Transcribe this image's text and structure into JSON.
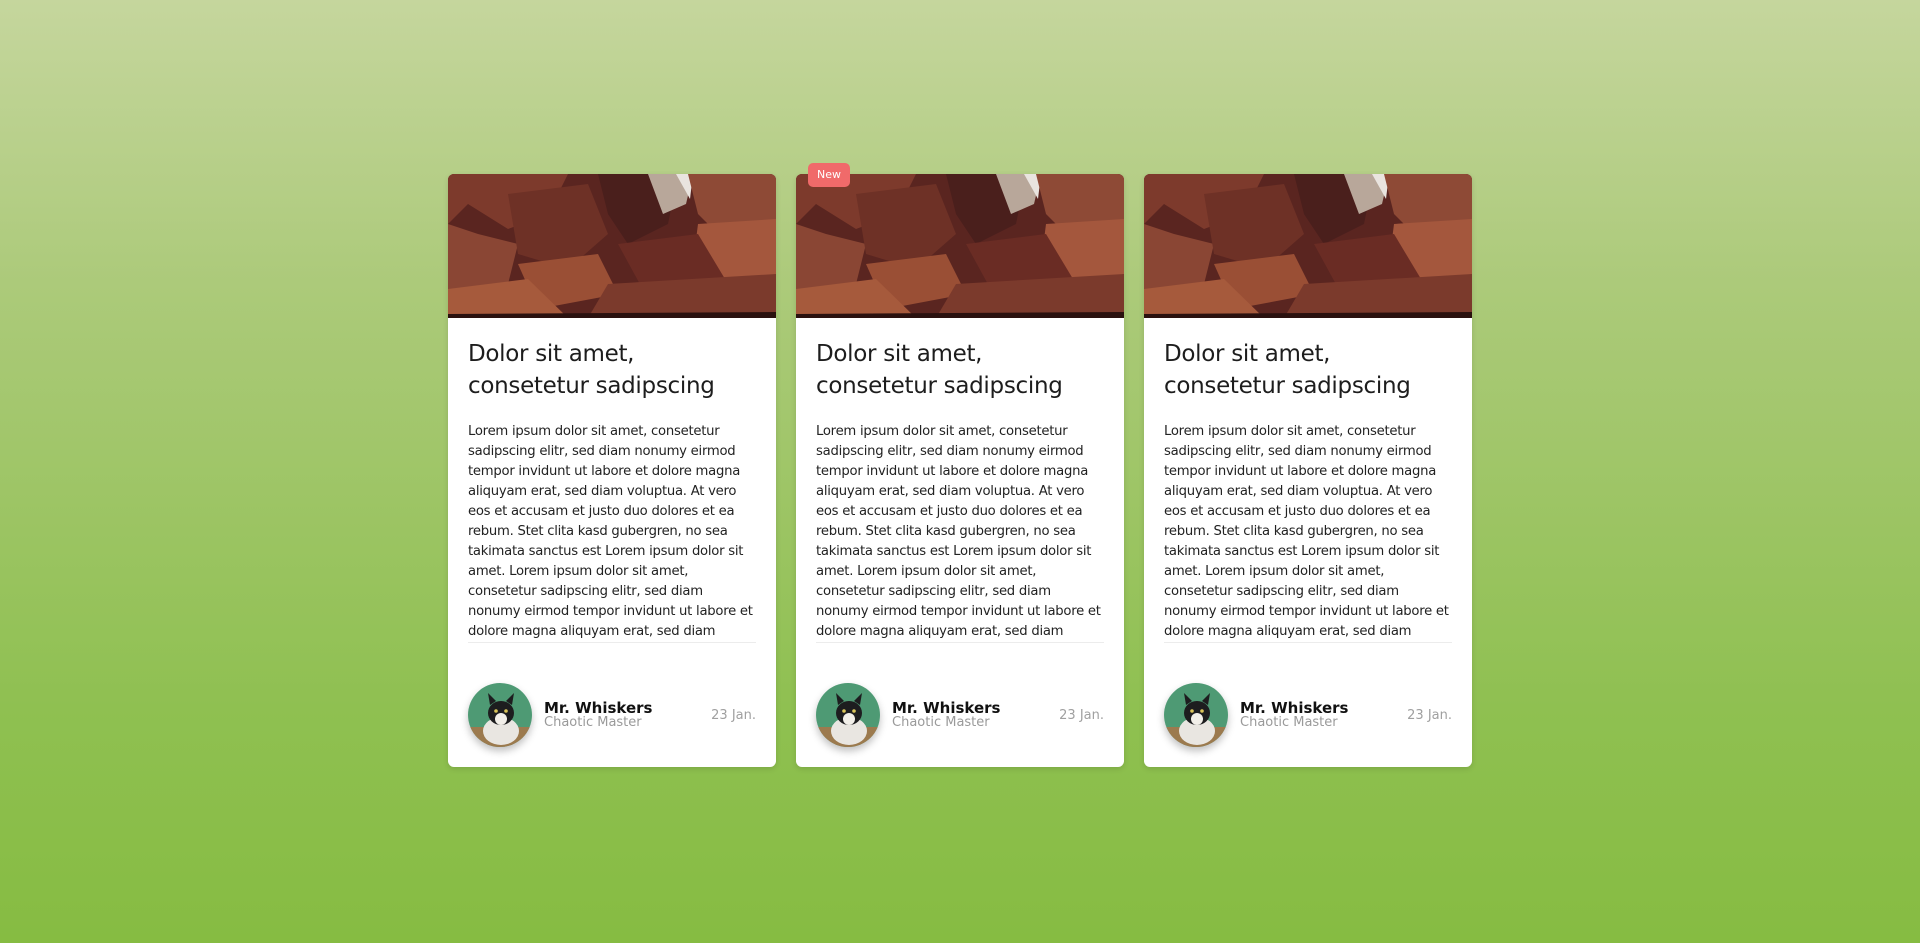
{
  "cards": [
    {
      "badge": "",
      "title": "Dolor sit amet, consetetur sadipscing",
      "text": "Lorem ipsum dolor sit amet, consetetur sadipscing elitr, sed diam nonumy eirmod tempor invidunt ut labore et dolore magna aliquyam erat, sed diam voluptua. At vero eos et accusam et justo duo dolores et ea rebum. Stet clita kasd gubergren, no sea takimata sanctus est Lorem ipsum dolor sit amet. Lorem ipsum dolor sit amet, consetetur sadipscing elitr, sed diam nonumy eirmod tempor invidunt ut labore et dolore magna aliquyam erat, sed diam voluptua. At vero eos et accusam et justo duo dolores et ea rebum.",
      "author": "Mr. Whiskers",
      "role": "Chaotic Master",
      "date": "23 Jan."
    },
    {
      "badge": "New",
      "title": "Dolor sit amet, consetetur sadipscing",
      "text": "Lorem ipsum dolor sit amet, consetetur sadipscing elitr, sed diam nonumy eirmod tempor invidunt ut labore et dolore magna aliquyam erat, sed diam voluptua. At vero eos et accusam et justo duo dolores et ea rebum. Stet clita kasd gubergren, no sea takimata sanctus est Lorem ipsum dolor sit amet. Lorem ipsum dolor sit amet, consetetur sadipscing elitr, sed diam nonumy eirmod tempor invidunt ut labore et dolore magna aliquyam erat, sed diam voluptua. At vero eos et accusam et justo duo dolores et ea rebum.",
      "author": "Mr. Whiskers",
      "role": "Chaotic Master",
      "date": "23 Jan."
    },
    {
      "badge": "",
      "title": "Dolor sit amet, consetetur sadipscing",
      "text": "Lorem ipsum dolor sit amet, consetetur sadipscing elitr, sed diam nonumy eirmod tempor invidunt ut labore et dolore magna aliquyam erat, sed diam voluptua. At vero eos et accusam et justo duo dolores et ea rebum. Stet clita kasd gubergren, no sea takimata sanctus est Lorem ipsum dolor sit amet. Lorem ipsum dolor sit amet, consetetur sadipscing elitr, sed diam nonumy eirmod tempor invidunt ut labore et dolore magna aliquyam erat, sed diam voluptua. At vero eos et accusam et justo duo dolores et ea rebum.",
      "author": "Mr. Whiskers",
      "role": "Chaotic Master",
      "date": "23 Jan."
    }
  ],
  "images": {
    "card_image": "red-rock-canyon-photo",
    "avatar": "cat-photo"
  },
  "colors": {
    "badge": "#f06a6a",
    "background_top": "#c5d69d",
    "background_bottom": "#86bc42",
    "avatar_bg": "#4e9a74"
  }
}
